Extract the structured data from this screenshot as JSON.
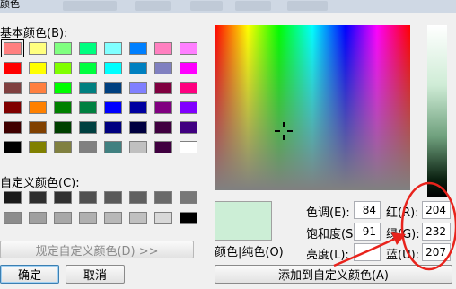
{
  "window": {
    "title": "颜色"
  },
  "basic_colors": {
    "label": "基本颜色(B):",
    "rows": [
      [
        "#ff8080",
        "#ffff80",
        "#80ff80",
        "#00ff80",
        "#80ffff",
        "#0080ff",
        "#ff80c0",
        "#ff80ff"
      ],
      [
        "#ff0000",
        "#ffff00",
        "#80ff00",
        "#00ff40",
        "#00ffff",
        "#0080c0",
        "#8080c0",
        "#ff00ff"
      ],
      [
        "#804040",
        "#ff8040",
        "#00ff00",
        "#008080",
        "#004080",
        "#8080ff",
        "#800040",
        "#ff0080"
      ],
      [
        "#800000",
        "#ff8000",
        "#008000",
        "#008040",
        "#0000ff",
        "#0000a0",
        "#800080",
        "#8000ff"
      ],
      [
        "#400000",
        "#804000",
        "#004000",
        "#004040",
        "#000080",
        "#000040",
        "#400040",
        "#400080"
      ],
      [
        "#000000",
        "#808000",
        "#808040",
        "#808080",
        "#408080",
        "#c0c0c0",
        "#400040",
        "#ffffff"
      ]
    ]
  },
  "custom_colors": {
    "label": "自定义颜色(C):",
    "rows": [
      [
        "#1a1a1a",
        "#2e2e2e",
        "#303030",
        "#505050",
        "#5a5a5a",
        "#606060",
        "#6a6a6a",
        "#787878"
      ],
      [
        "#8c8c8c",
        "#a0a0a0",
        "#a8a8a8",
        "#b0b0b0",
        "#b8b8b8",
        "#c0c0c0",
        "#d8d8d8",
        "#000000"
      ]
    ]
  },
  "define_custom_button": "规定自定义颜色(D) >>",
  "ok_button": "确定",
  "cancel_button": "取消",
  "preview_label": "颜色|纯色(O)",
  "add_custom_button": "添加到自定义颜色(A)",
  "fields": {
    "hue": {
      "label": "色调(E):",
      "value": "84"
    },
    "sat": {
      "label": "饱和度(S):",
      "value": "91"
    },
    "lum": {
      "label": "亮度(L):",
      "value": ""
    },
    "red": {
      "label": "红(R):",
      "value": "204"
    },
    "green": {
      "label": "绿(G):",
      "value": "232"
    },
    "blue": {
      "label": "蓝(U):",
      "value": "207"
    }
  },
  "colors": {
    "preview": "#cceed6",
    "annotation": "#e8231c"
  }
}
